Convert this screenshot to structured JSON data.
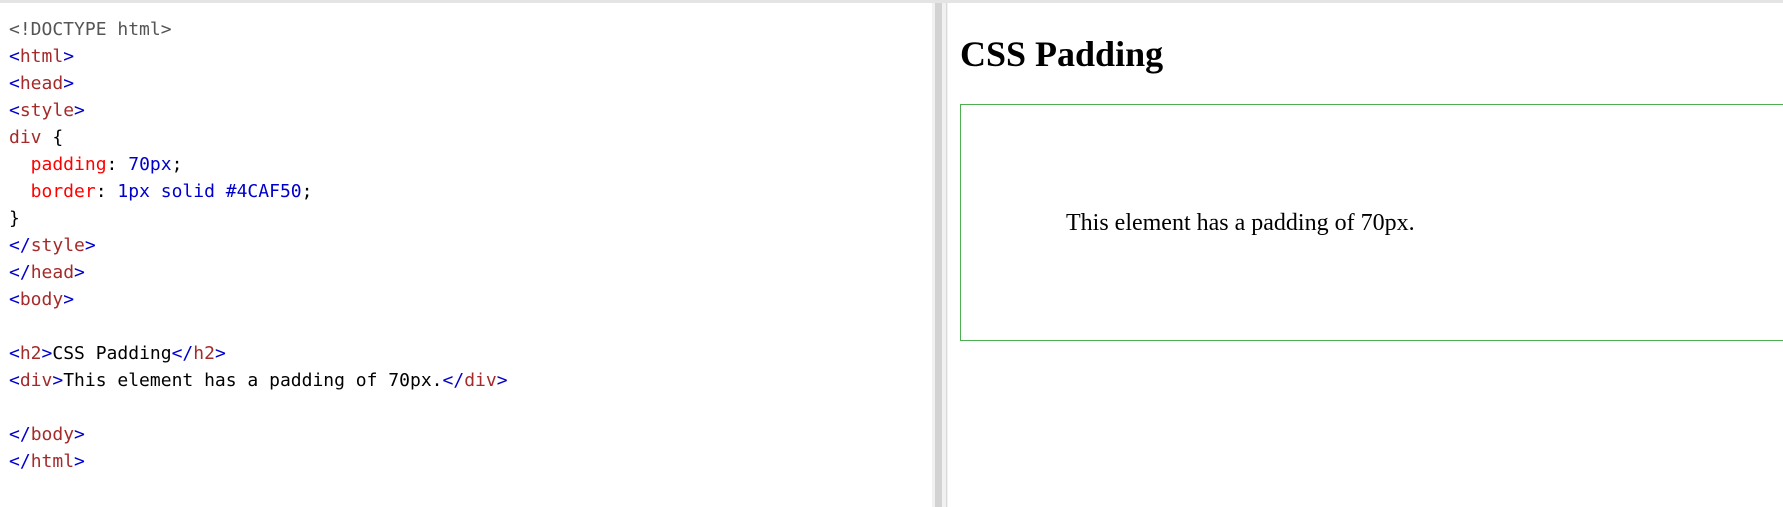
{
  "editor": {
    "code_lines": [
      [
        {
          "t": "<!DOCTYPE html>",
          "c": "doctype"
        }
      ],
      [
        {
          "t": "<",
          "c": "angle"
        },
        {
          "t": "html",
          "c": "tag"
        },
        {
          "t": ">",
          "c": "angle"
        }
      ],
      [
        {
          "t": "<",
          "c": "angle"
        },
        {
          "t": "head",
          "c": "tag"
        },
        {
          "t": ">",
          "c": "angle"
        }
      ],
      [
        {
          "t": "<",
          "c": "angle"
        },
        {
          "t": "style",
          "c": "tag"
        },
        {
          "t": ">",
          "c": "angle"
        }
      ],
      [
        {
          "t": "div",
          "c": "tag"
        },
        {
          "t": " {",
          "c": "plain"
        }
      ],
      [
        {
          "t": "  padding",
          "c": "prop"
        },
        {
          "t": ": ",
          "c": "plain"
        },
        {
          "t": "70px",
          "c": "val"
        },
        {
          "t": ";",
          "c": "plain"
        }
      ],
      [
        {
          "t": "  border",
          "c": "prop"
        },
        {
          "t": ": ",
          "c": "plain"
        },
        {
          "t": "1px solid #4CAF50",
          "c": "val"
        },
        {
          "t": ";",
          "c": "plain"
        }
      ],
      [
        {
          "t": "}",
          "c": "plain"
        }
      ],
      [
        {
          "t": "</",
          "c": "angle"
        },
        {
          "t": "style",
          "c": "tag"
        },
        {
          "t": ">",
          "c": "angle"
        }
      ],
      [
        {
          "t": "</",
          "c": "angle"
        },
        {
          "t": "head",
          "c": "tag"
        },
        {
          "t": ">",
          "c": "angle"
        }
      ],
      [
        {
          "t": "<",
          "c": "angle"
        },
        {
          "t": "body",
          "c": "tag"
        },
        {
          "t": ">",
          "c": "angle"
        }
      ],
      [],
      [
        {
          "t": "<",
          "c": "angle"
        },
        {
          "t": "h2",
          "c": "tag"
        },
        {
          "t": ">",
          "c": "angle"
        },
        {
          "t": "CSS Padding",
          "c": "plain"
        },
        {
          "t": "</",
          "c": "angle"
        },
        {
          "t": "h2",
          "c": "tag"
        },
        {
          "t": ">",
          "c": "angle"
        }
      ],
      [
        {
          "t": "<",
          "c": "angle"
        },
        {
          "t": "div",
          "c": "tag"
        },
        {
          "t": ">",
          "c": "angle"
        },
        {
          "t": "This element has a padding of 70px.",
          "c": "plain"
        },
        {
          "t": "</",
          "c": "angle"
        },
        {
          "t": "div",
          "c": "tag"
        },
        {
          "t": ">",
          "c": "angle"
        }
      ],
      [],
      [
        {
          "t": "</",
          "c": "angle"
        },
        {
          "t": "body",
          "c": "tag"
        },
        {
          "t": ">",
          "c": "angle"
        }
      ],
      [
        {
          "t": "</",
          "c": "angle"
        },
        {
          "t": "html",
          "c": "tag"
        },
        {
          "t": ">",
          "c": "angle"
        }
      ]
    ]
  },
  "result": {
    "title": "CSS Padding",
    "box_text": "This element has a padding of 70px.",
    "box_border_color": "#4CAF50"
  }
}
